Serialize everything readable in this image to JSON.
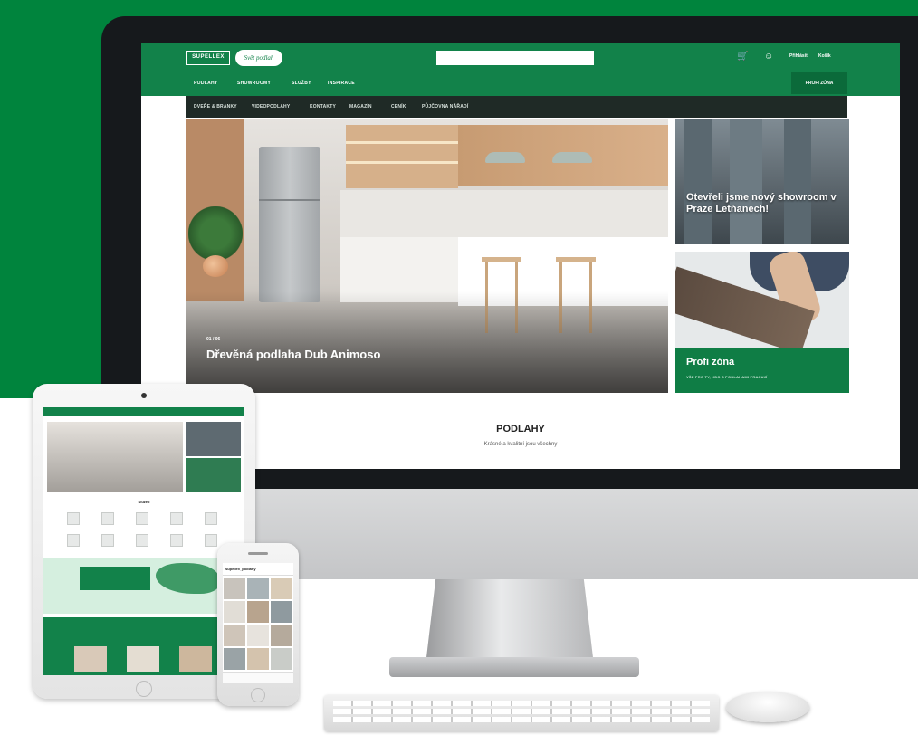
{
  "header": {
    "logo_text": "SUPELLEX",
    "logo_script": "Svět podlah",
    "search_placeholder": "",
    "links": [
      "Přihlásit",
      "Košík"
    ]
  },
  "nav": {
    "items": [
      "PODLAHY",
      "SHOWROOMY",
      "SLUŽBY",
      "INSPIRACE"
    ],
    "profi_button": "PROFI ZÓNA"
  },
  "subnav": {
    "items": [
      "DVEŘE & BRANKY",
      "VIDEOPODLAHY",
      "KONTAKTY",
      "MAGAZÍN",
      "CENÍK",
      "PŮJČOVNA NÁŘADÍ"
    ]
  },
  "hero": {
    "counter": "01 / 06",
    "title": "Dřevěná podlaha Dub Animoso"
  },
  "tile_top": {
    "title": "Otevřeli jsme nový showroom v Praze Letňanech!"
  },
  "tile_bottom": {
    "title": "Profi zóna",
    "subtitle": "VŠE PRO TY, KDO S PODLAHAMI PRACUJÍ"
  },
  "section": {
    "title": "PODLAHY",
    "subtitle": "Krásné a kvalitní jsou všechny"
  },
  "tablet": {
    "section_title": "Sluzeb"
  },
  "phone": {
    "handle": "supellex_podlahy"
  },
  "colors": {
    "brand_green": "#12824a",
    "backdrop_green": "#00843d",
    "subnav_dark": "#1f2a26"
  }
}
